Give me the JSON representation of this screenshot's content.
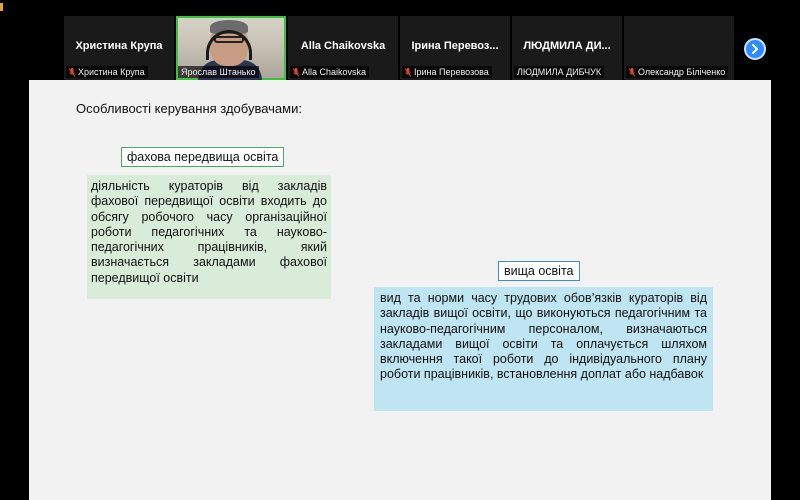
{
  "participants": [
    {
      "display_name": "Христина Крупа",
      "caption": "Христина Крупа",
      "muted": true,
      "video": false
    },
    {
      "display_name": "",
      "caption": "Ярослав Штанько",
      "muted": false,
      "video": true
    },
    {
      "display_name": "Alla Chaikovska",
      "caption": "Alla Chaikovska",
      "muted": true,
      "video": false
    },
    {
      "display_name": "Ірина  Перевоз...",
      "caption": "Ірина Перевозова",
      "muted": true,
      "video": false
    },
    {
      "display_name": "ЛЮДМИЛА ДИ...",
      "caption": "ЛЮДМИЛА ДИБЧУК",
      "muted": false,
      "video": false
    },
    {
      "display_name": "",
      "caption": "Олександр Біліченко",
      "muted": true,
      "video": false
    }
  ],
  "slide": {
    "heading": "Особливості керування здобувачами:",
    "section1": {
      "label": "фахова передвища освіта",
      "text": "діяльність кураторів від закладів фахової передвищої освіти входить до обсягу робочого часу організаційної роботи педагогічних та науково-педагогічних працівників, який визначається закладами фахової передвищої освіти"
    },
    "section2": {
      "label": "вища освіта",
      "text": "вид та норми часу трудових обов’язків кураторів від закладів вищої освіти, що виконуються  педагогічним та науково-педагогічним персоналом, визначаються закладами вищої освіти та оплачується шляхом включення такої роботи до індивідуального плану роботи працівників, встановлення доплат або надбавок"
    }
  },
  "colors": {
    "active_speaker": "#39c339",
    "muted_icon": "#e0453a",
    "accent_button": "#2d8cff",
    "green_box": "#d9ecda",
    "blue_box": "#bfe4f2"
  }
}
